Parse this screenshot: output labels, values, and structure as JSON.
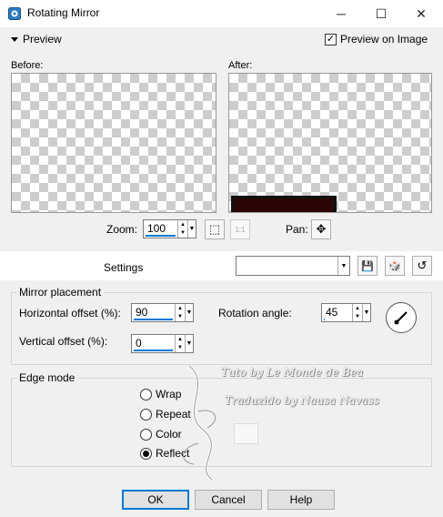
{
  "window": {
    "title": "Rotating Mirror",
    "icon": "app-icon",
    "minimize_icon": "─",
    "maximize_icon": "☐",
    "close_icon": "✕"
  },
  "preview": {
    "toggle_label": "Preview",
    "preview_on_image_label": "Preview on Image",
    "preview_on_image_checked": true,
    "check_glyph": "✓",
    "before_label": "Before:",
    "after_label": "After:"
  },
  "zoom": {
    "label": "Zoom:",
    "value": "100",
    "fit_icon": "⬚",
    "actual_icon": "1:1",
    "pan_label": "Pan:",
    "pan_icon": "✥"
  },
  "settings": {
    "label": "Settings",
    "preset_value": "",
    "save_icon": "💾",
    "random_icon": "🎲",
    "reset_icon": "↺"
  },
  "mirror_placement": {
    "title": "Mirror placement",
    "horizontal_label": "Horizontal offset (%):",
    "horizontal_value": "90",
    "vertical_label": "Vertical offset (%):",
    "vertical_value": "0",
    "rotation_label": "Rotation angle:",
    "rotation_value": "45"
  },
  "edge_mode": {
    "title": "Edge mode",
    "options": [
      "Wrap",
      "Repeat",
      "Color",
      "Reflect"
    ],
    "selected": "Reflect"
  },
  "buttons": {
    "ok": "OK",
    "cancel": "Cancel",
    "help": "Help"
  },
  "spin_glyphs": {
    "up": "▲",
    "down": "▼",
    "dd": "▼"
  },
  "watermark": {
    "line1": "Tuto by Le Monde de Bea",
    "line2": "Traduzido by Nausa Navass"
  },
  "colors": {
    "accent": "#0078d7",
    "after_bar": "#2a0606"
  }
}
